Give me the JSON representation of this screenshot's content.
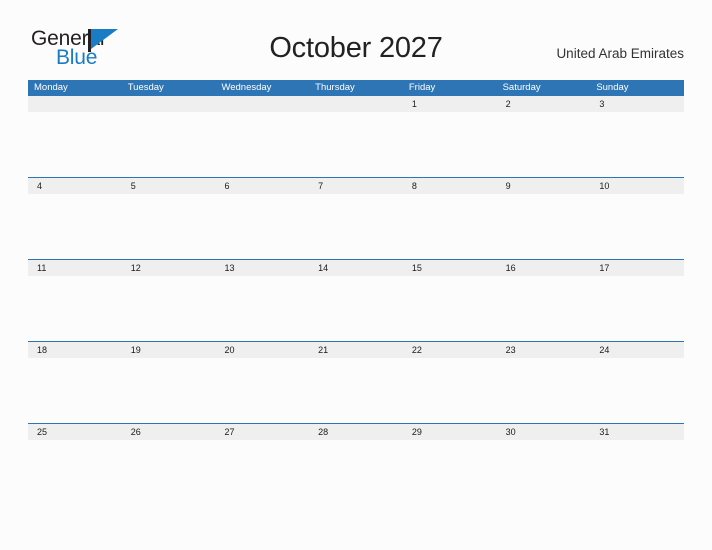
{
  "brand": {
    "name_part1": "General",
    "name_part2": "Blue",
    "flag_icon": "triangle-flag-icon",
    "color_text": "#231f20",
    "color_blue": "#1a7cc4"
  },
  "header": {
    "title": "October 2027",
    "country": "United Arab Emirates"
  },
  "theme": {
    "header_blue": "#2e75b6",
    "date_band_gray": "#efefef",
    "page_background": "#fcfcfc",
    "date_text": "#1a1a1a"
  },
  "calendar": {
    "month": "October",
    "year": "2027",
    "weekday_headers": [
      "Monday",
      "Tuesday",
      "Wednesday",
      "Thursday",
      "Friday",
      "Saturday",
      "Sunday"
    ],
    "weeks": [
      {
        "rule": false,
        "days": [
          "",
          "",
          "",
          "",
          "1",
          "2",
          "3"
        ]
      },
      {
        "rule": true,
        "days": [
          "4",
          "5",
          "6",
          "7",
          "8",
          "9",
          "10"
        ]
      },
      {
        "rule": true,
        "days": [
          "11",
          "12",
          "13",
          "14",
          "15",
          "16",
          "17"
        ]
      },
      {
        "rule": true,
        "days": [
          "18",
          "19",
          "20",
          "21",
          "22",
          "23",
          "24"
        ]
      },
      {
        "rule": true,
        "days": [
          "25",
          "26",
          "27",
          "28",
          "29",
          "30",
          "31"
        ]
      }
    ]
  }
}
